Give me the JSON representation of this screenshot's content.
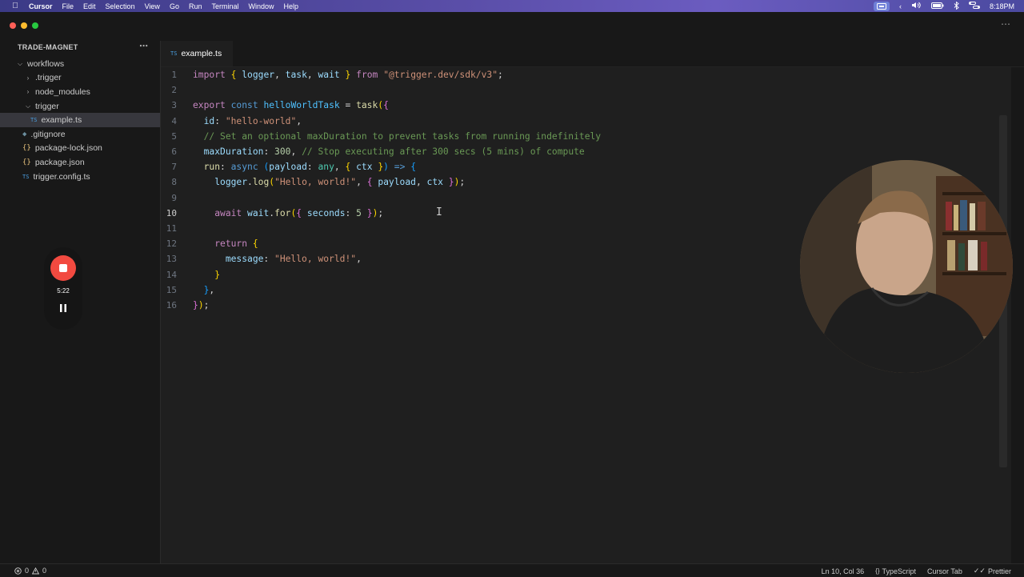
{
  "menubar": {
    "apple_icon": "apple-icon",
    "app_name": "Cursor",
    "items": [
      "File",
      "Edit",
      "Selection",
      "View",
      "Go",
      "Run",
      "Terminal",
      "Window",
      "Help"
    ],
    "time": "8:18PM"
  },
  "explorer": {
    "title": "TRADE-MAGNET",
    "more_icon": "ellipsis-icon",
    "items": [
      {
        "label": "workflows",
        "type": "folder",
        "expanded": true
      },
      {
        "label": ".trigger",
        "type": "folder",
        "expanded": false
      },
      {
        "label": "node_modules",
        "type": "folder",
        "expanded": false
      },
      {
        "label": "trigger",
        "type": "folder",
        "expanded": true
      },
      {
        "label": "example.ts",
        "type": "ts",
        "selected": true
      },
      {
        "label": ".gitignore",
        "type": "git"
      },
      {
        "label": "package-lock.json",
        "type": "json"
      },
      {
        "label": "package.json",
        "type": "json"
      },
      {
        "label": "trigger.config.ts",
        "type": "ts"
      }
    ]
  },
  "recorder": {
    "time": "5:22"
  },
  "editor": {
    "tab_label": "example.ts",
    "file_icon_text": "TS",
    "active_line": 10,
    "lines": [
      "import { logger, task, wait } from \"@trigger.dev/sdk/v3\";",
      "",
      "export const helloWorldTask = task({",
      "  id: \"hello-world\",",
      "  // Set an optional maxDuration to prevent tasks from running indefinitely",
      "  maxDuration: 300, // Stop executing after 300 secs (5 mins) of compute",
      "  run: async (payload: any, { ctx }) => {",
      "    logger.log(\"Hello, world!\", { payload, ctx });",
      "",
      "    await wait.for({ seconds: 5 });",
      "",
      "    return {",
      "      message: \"Hello, world!\",",
      "    }",
      "  },",
      "});"
    ]
  },
  "statusbar": {
    "errors": "0",
    "warnings": "0",
    "position": "Ln 10, Col 36",
    "language": "TypeScript",
    "cursor_tab": "Cursor Tab",
    "formatter": "Prettier"
  }
}
